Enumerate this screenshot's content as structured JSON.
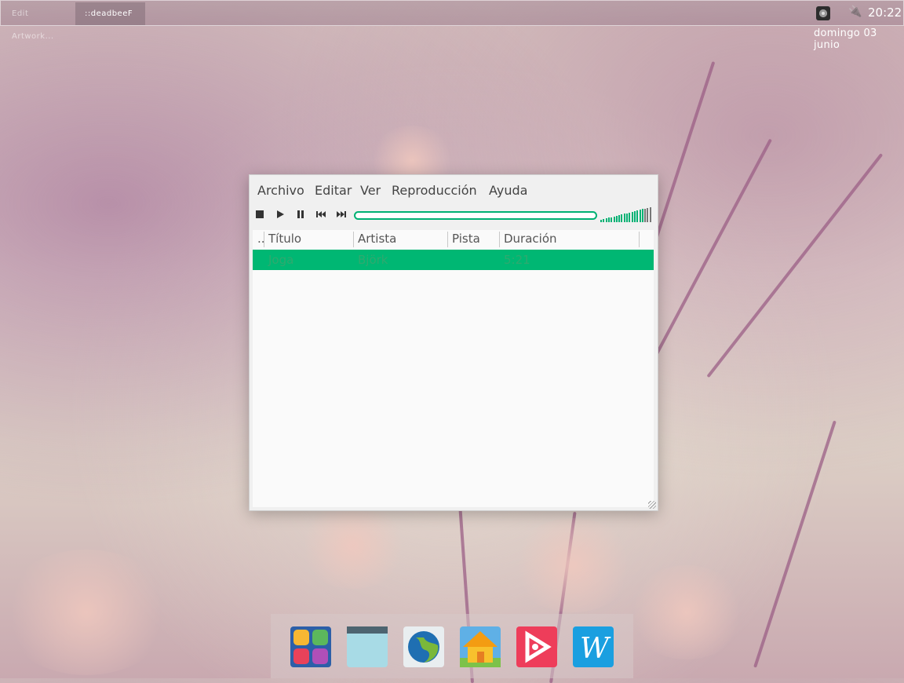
{
  "taskbar": {
    "tasks": [
      {
        "label": "Edit Artwork..."
      },
      {
        "label": "::deadbeeF"
      }
    ],
    "clock": "20:22",
    "date": "domingo 03 junio"
  },
  "player": {
    "menu": [
      "Archivo",
      "Editar",
      "Ver",
      "Reproducción",
      "Ayuda"
    ],
    "controls": {
      "stop_icon": "stop-icon",
      "play_icon": "play-icon",
      "pause_icon": "pause-icon",
      "prev_icon": "prev-icon",
      "next_icon": "next-icon"
    },
    "columns": {
      "status": "..",
      "title": "Título",
      "artist": "Artista",
      "track": "Pista",
      "duration": "Duración"
    },
    "rows": [
      {
        "title": "Joga",
        "artist": "Björk",
        "track": "",
        "duration": "5:21"
      }
    ],
    "accent_color": "#00b773"
  },
  "dock": {
    "icons": [
      "app-grid-icon",
      "file-manager-icon",
      "browser-globe-icon",
      "home-folder-icon",
      "media-player-icon",
      "writer-icon"
    ]
  }
}
